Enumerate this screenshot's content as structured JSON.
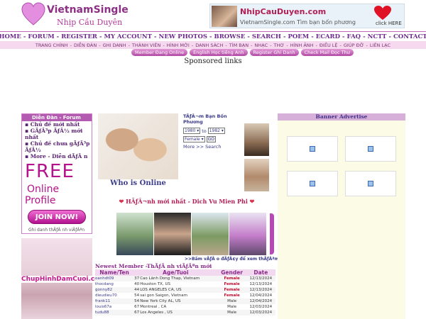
{
  "header": {
    "logo_title": "VietnamSingle",
    "logo_sub": "Nhịp Cầu Duyên",
    "banner_title": "NhipCauDuyen.com",
    "banner_sub": "VietnamSingle.com Tìm bạn bốn phương",
    "banner_click": "click HERE"
  },
  "nav": {
    "items": [
      "HOME",
      "FORUM",
      "REGISTER",
      "MY ACCOUNT",
      "NEW PHOTOS",
      "BROWSE",
      "SEARCH",
      "POEM",
      "ECARD",
      "FAQ",
      "NCTT",
      "CONTACT"
    ]
  },
  "subnav": {
    "items": [
      "TRANG CHÍNH",
      "DIỄN ĐÀN",
      "GHI DANH",
      "THÀNH VIÊN",
      "HÌNH MỚI",
      "DANH SÁCH",
      "TÌM BẠN",
      "NHẠC",
      "THƠ",
      "HÌNH ẢNH",
      "ĐIỀU LỆ",
      "GIÚP ĐỠ",
      "LIÊN LẠC"
    ]
  },
  "pills": [
    "Member Đang Online",
    "English Học tiếng Anh",
    "Register Ghi Danh",
    "Check Mail Đọc Thư"
  ],
  "sponsored": "Sponsored links",
  "forum": {
    "head": "Diễn Đàn - Forum",
    "items": [
      "Chủ đề mới nhất",
      "GÃƒÂ³p ÃƒÂ½ mới nhất",
      "Chủ đề chưa gÃƒÂ³p ÃƒÂ½",
      "More - Diễn dÃƒÂ n"
    ]
  },
  "promo": {
    "free": "FREE",
    "online": "Online",
    "profile": "Profile",
    "join": "JOIN NOW!",
    "join_sub": "Ghi danh thÃƒÂ nh viÃƒÂªn"
  },
  "left_ad": {
    "label": "ChupHinhDamCuoi.com"
  },
  "who_online": "Who is Online",
  "search": {
    "title": "TÃƒÂ¬m Bạn Bốn Phương",
    "from": "1980",
    "to_label": "to",
    "to": "1982",
    "gender": "Female",
    "go": "GO",
    "more": "More >> Search"
  },
  "news": {
    "title": "HÃƒÂ¬nh mới nhất - Dich Vu Mien Phi"
  },
  "more_link": ">>Bấm vÃƒÂ o đÃƒÂ¢y để xem thÃƒÂªm",
  "members": {
    "title": "Newest Member -ThÃƒÂ nh viÃƒÂªn mới",
    "headers": [
      "Name/Ten",
      "Age/Tuoi",
      "Gender",
      "Date"
    ],
    "rows": [
      {
        "name": "oanhdt09",
        "age": "37",
        "loc": "Cao Lãnh  Dong Thap, Vietnam",
        "gender": "Female",
        "date": "12/13/2024",
        "female": true
      },
      {
        "name": "thocdang",
        "age": "40",
        "loc": "Houston TX, US",
        "gender": "Female",
        "date": "12/13/2024",
        "female": true
      },
      {
        "name": "gonny82",
        "age": "44",
        "loc": "LOS ANGELES CA, US",
        "gender": "Female",
        "date": "12/13/2024",
        "female": true
      },
      {
        "name": "dieudieu70",
        "age": "54",
        "loc": "sai gon  Saigon, Vietnam",
        "gender": "Female",
        "date": "12/04/2024",
        "female": true
      },
      {
        "name": "frank11",
        "age": "54",
        "loc": "New York City AL, US",
        "gender": "Male",
        "date": "12/04/2024",
        "female": false
      },
      {
        "name": "louis67a",
        "age": "67",
        "loc": "Montreal , CA",
        "gender": "Male",
        "date": "12/03/2024",
        "female": false
      },
      {
        "name": "tudu88",
        "age": "67",
        "loc": "Los Angeles , US",
        "gender": "Male",
        "date": "12/03/2024",
        "female": false
      }
    ]
  },
  "banner_advertise": "Banner Advertise",
  "colors": {
    "brand": "#8e2f86",
    "accent": "#b5128e",
    "nav": "#6d2a8a"
  }
}
